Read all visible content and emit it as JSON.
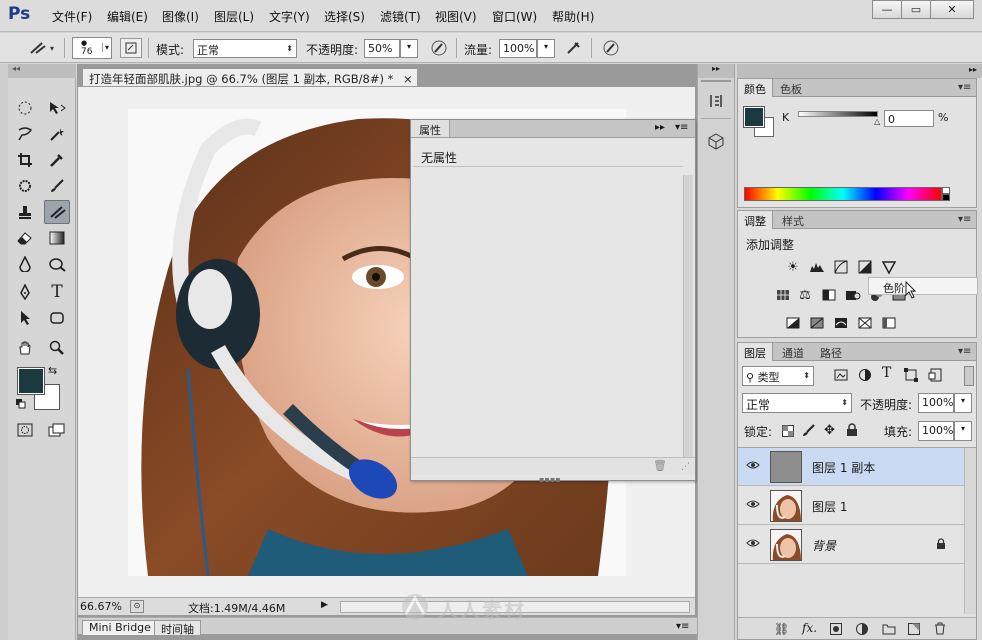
{
  "app": {
    "logo": "Ps"
  },
  "menu": [
    "文件(F)",
    "编辑(E)",
    "图像(I)",
    "图层(L)",
    "文字(Y)",
    "选择(S)",
    "滤镜(T)",
    "视图(V)",
    "窗口(W)",
    "帮助(H)"
  ],
  "window_controls": {
    "minimize": "—",
    "restore": "▭",
    "close": "✕"
  },
  "options": {
    "brush_size": "76",
    "mode_label": "模式:",
    "mode_value": "正常",
    "opacity_label": "不透明度:",
    "opacity_value": "50%",
    "flow_label": "流量:",
    "flow_value": "100%"
  },
  "document": {
    "tab_title": "打造年轻面部肌肤.jpg @ 66.7% (图层 1 副本, RGB/8#) *",
    "close": "×"
  },
  "statusbar": {
    "zoom": "66.67%",
    "doc_info": "文档:1.49M/4.46M"
  },
  "bottom_tabs": [
    "Mini Bridge",
    "时间轴"
  ],
  "properties_panel": {
    "tab": "属性",
    "content": "无属性"
  },
  "color_panel": {
    "tabs": [
      "颜色",
      "色板"
    ],
    "channel_label": "K",
    "channel_value": "0",
    "unit": "%",
    "foreground_color": "#1b3a40",
    "background_color": "#ffffff"
  },
  "adjustments_panel": {
    "tabs": [
      "调整",
      "样式"
    ],
    "heading": "添加调整",
    "tooltip": "色阶..."
  },
  "layers_panel": {
    "tabs": [
      "图层",
      "通道",
      "路径"
    ],
    "filter_label": "类型",
    "blend_mode": "正常",
    "opacity_label": "不透明度:",
    "opacity_value": "100%",
    "lock_label": "锁定:",
    "fill_label": "填充:",
    "fill_value": "100%",
    "layers": [
      {
        "name": "图层 1 副本",
        "selected": true
      },
      {
        "name": "图层 1",
        "selected": false
      },
      {
        "name": "背景",
        "selected": false,
        "italic": true
      }
    ]
  },
  "watermark": "人人素材"
}
